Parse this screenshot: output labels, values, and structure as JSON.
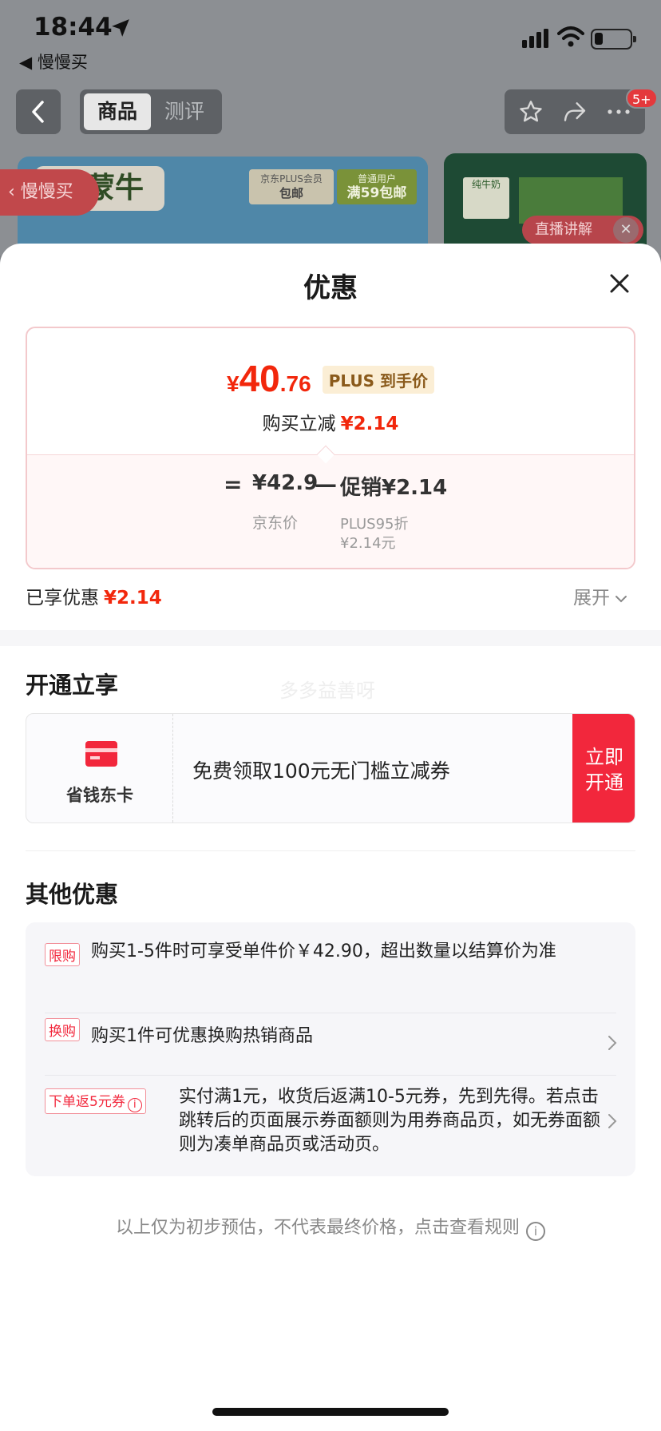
{
  "status_bar": {
    "time": "18:44",
    "back_app": "◀ 慢慢买"
  },
  "nav": {
    "tabs": [
      {
        "label": "商品",
        "active": true
      },
      {
        "label": "测评",
        "active": false
      }
    ],
    "badge": "5+"
  },
  "background": {
    "brand": "蒙牛",
    "plus_label": "京东PLUS会员",
    "plus_value": "包邮",
    "normal_label": "普通用户",
    "normal_value": "满59包邮",
    "product_name": "纯牛奶",
    "live_tag": "直播讲解",
    "slow_buy_tab": "慢慢买"
  },
  "sheet": {
    "title": "优惠",
    "price": {
      "currency": "¥",
      "integer": "40",
      "decimal": ".76",
      "tag": "PLUS 到手价",
      "reduce_label": "购买立减",
      "reduce_value": "¥2.14"
    },
    "breakdown": {
      "equals": "=",
      "jd_price": "¥42.9",
      "minus": "—",
      "promo": "促销¥2.14",
      "jd_label": "京东价",
      "promo_sub1": "PLUS95折",
      "promo_sub2": "¥2.14元"
    },
    "enjoyed_label": "已享优惠",
    "enjoyed_value": "¥2.14",
    "expand_label": "展开",
    "open_section": {
      "title": "开通立享",
      "watermark": "多多益善呀",
      "card_name": "省钱东卡",
      "card_desc": "免费领取100元无门槛立减券",
      "card_btn": "立即开通"
    },
    "other_section": {
      "title": "其他优惠",
      "rows": [
        {
          "tag": "限购",
          "text": "购买1-5件时可享受单件价￥42.90，超出数量以结算价为准"
        },
        {
          "tag": "换购",
          "text": "购买1件可优惠换购热销商品"
        },
        {
          "tag": "下单返5元券",
          "text": "实付满1元，收货后返满10-5元券，先到先得。若点击跳转后的页面展示券面额则为用券商品页，如无券面额则为凑单商品页或活动页。"
        }
      ]
    },
    "disclaimer": "以上仅为初步预估，不代表最终价格，点击查看规则"
  }
}
